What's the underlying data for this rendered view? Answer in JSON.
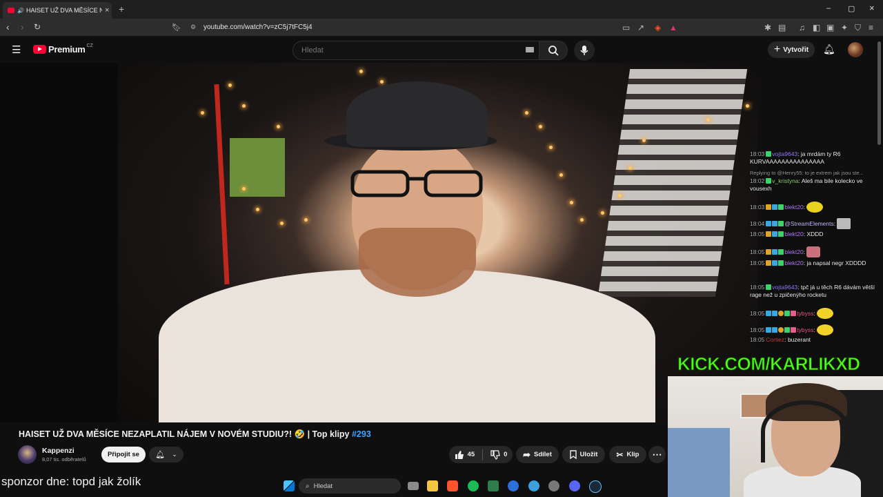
{
  "browser": {
    "tab_title": "HAISET UŽ DVA MĚSÍCE NEZAPLATIL NÁJEM V NOVÉM STUDIU?!",
    "new_tab": "+",
    "close_tab": "×",
    "url": "youtube.com/watch?v=zC5j7tFC5j4",
    "window_controls": [
      "–",
      "▢",
      "×"
    ]
  },
  "youtube": {
    "logo_text": "Premium",
    "logo_country": "CZ",
    "search_placeholder": "Hledat",
    "create_label": "Vytvořit"
  },
  "chat": [
    {
      "time": "18:03",
      "user": "vojta9643",
      "user_color": "#9b7bff",
      "text": "ja mrdám ty R6 KURVAAAAAAAAAAAAAAA"
    },
    {
      "reply": "Replying to @Henry55: to je extrem jak jsou ste..."
    },
    {
      "time": "18:02",
      "user": "v_kristyna",
      "user_color": "#8ed16a",
      "text": "Aleš ma bile kolecko ve vousexh"
    },
    {
      "time": "18:03",
      "user": "blekt20",
      "user_color": "#b57bff",
      "text": ""
    },
    {
      "time": "18:04",
      "user": "@StreamElements",
      "user_color": "#c9b8ff",
      "text": ""
    },
    {
      "time": "18:05",
      "user": "blekt20",
      "user_color": "#b57bff",
      "text": "XDDD"
    },
    {
      "time": "18:05",
      "user": "blekt20",
      "user_color": "#b57bff",
      "text": ""
    },
    {
      "time": "18:05",
      "user": "blekt20",
      "user_color": "#b57bff",
      "text": "ja napsal negr XDDDD"
    },
    {
      "time": "18:05",
      "user": "vojta9643",
      "user_color": "#9b7bff",
      "text": "tpč já u těch R6 dávám větší rage než u zpičenýho rocketu"
    },
    {
      "time": "18:05",
      "user": "tybyss",
      "user_color": "#e85d8c",
      "text": ""
    },
    {
      "time": "18:05",
      "user": "tybyss",
      "user_color": "#e85d8c",
      "text": ""
    },
    {
      "time": "18:05",
      "user": "Cortiez",
      "user_color": "#d23b3b",
      "text": "buzerant"
    }
  ],
  "overlay": {
    "kick_text": "KICK.COM/KARLIKXD"
  },
  "video": {
    "title": "HAISET UŽ DVA MĚSÍCE NEZAPLATIL NÁJEM V NOVÉM STUDIU?! 🤣 | Top klipy",
    "hashtag": "#293",
    "channel": "Kappenzi",
    "subscribers": "8,07 tis. odběratelů",
    "join_label": "Připojit se",
    "likes": "45",
    "dislikes": "0",
    "share_label": "Sdílet",
    "save_label": "Uložit",
    "clip_label": "Klip",
    "more_label": "⋯"
  },
  "sponsor_text": "sponzor dne: topd jak žolík",
  "taskbar": {
    "search_label": "Hledat"
  },
  "colors": {
    "youtube_red": "#ff0033",
    "kick_green": "#53fc18",
    "hashtag_blue": "#3ea6ff"
  }
}
